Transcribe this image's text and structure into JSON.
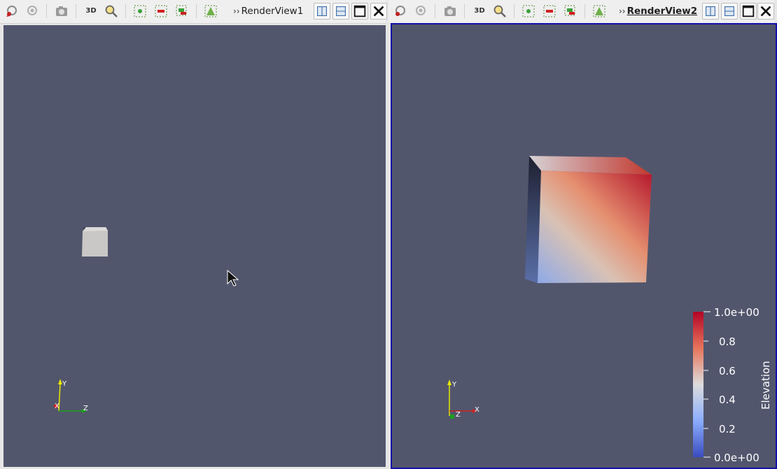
{
  "views": [
    {
      "title": "RenderView1",
      "active": false,
      "toolbar": {
        "icons": [
          "reset-camera-icon",
          "reset-camera-closest-icon",
          "capture-screenshot-icon",
          "toggle-3d-label",
          "zoom-to-box-icon",
          "select-points-icon",
          "select-cells-icon",
          "select-block-icon",
          "show-axes-icon"
        ],
        "label_3d": "3D"
      },
      "axes": {
        "y": "Y",
        "x": "X",
        "z": "Z"
      }
    },
    {
      "title": "RenderView2",
      "active": true,
      "toolbar": {
        "label_3d": "3D"
      },
      "axes": {
        "y": "Y",
        "z": "Z",
        "x": "X"
      },
      "colorbar": {
        "title": "Elevation",
        "labels": [
          "1.0e+00",
          "0.8",
          "0.6",
          "0.4",
          "0.2",
          "0.0e+00"
        ],
        "colors": [
          "#b40426",
          "#e7745b",
          "#dddcdc",
          "#8badfd",
          "#3b4cc0"
        ]
      }
    }
  ],
  "background_color": "#52566d",
  "active_border_color": "#1410a8"
}
